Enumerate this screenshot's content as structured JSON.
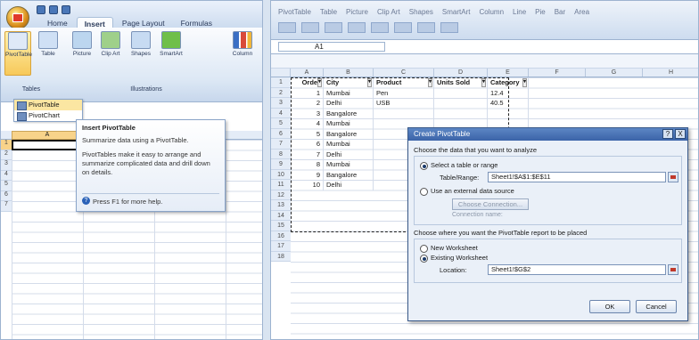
{
  "left": {
    "quick_access": [
      "save-icon",
      "undo-icon",
      "redo-icon"
    ],
    "tabs": [
      "Home",
      "Insert",
      "Page Layout",
      "Formulas"
    ],
    "active_tab": "Insert",
    "ribbon_buttons": [
      {
        "label": "PivotTable",
        "icon": "pivottable-icon",
        "highlight": true
      },
      {
        "label": "Table",
        "icon": "table-icon"
      },
      {
        "label": "Picture",
        "icon": "picture-icon"
      },
      {
        "label": "Clip Art",
        "icon": "clipart-icon"
      },
      {
        "label": "Shapes",
        "icon": "shapes-icon"
      },
      {
        "label": "SmartArt",
        "icon": "smartart-icon"
      },
      {
        "label": "Column",
        "icon": "column-chart-icon"
      }
    ],
    "group_labels": {
      "tables": "Tables",
      "illustrations": "Illustrations"
    },
    "dropdown_items": [
      "PivotTable",
      "PivotChart"
    ],
    "tooltip": {
      "title": "Insert PivotTable",
      "line1": "Summarize data using a PivotTable.",
      "line2": "PivotTables make it easy to arrange and summarize complicated data and drill down on details.",
      "help": "Press F1 for more help."
    },
    "col_header": "A",
    "rows": [
      "1",
      "2",
      "3",
      "4",
      "5",
      "6",
      "7"
    ]
  },
  "right": {
    "ribbon_tabs": [
      "PivotTable",
      "Table",
      "Picture",
      "Clip Art",
      "Shapes",
      "SmartArt",
      "Column",
      "Line",
      "Pie",
      "Bar",
      "Area"
    ],
    "name_box": "A1",
    "col_headers": [
      "",
      "A",
      "B",
      "C",
      "D",
      "E",
      "F",
      "G",
      "H"
    ],
    "row_numbers": [
      "1",
      "2",
      "3",
      "4",
      "5",
      "6",
      "7",
      "8",
      "9",
      "10",
      "11",
      "12",
      "13",
      "14",
      "15",
      "16",
      "17",
      "18"
    ],
    "table_headers": [
      "Order",
      "City",
      "Product",
      "Units Sold",
      "Category"
    ],
    "table_rows": [
      [
        "1",
        "Mumbai",
        "Pen",
        "",
        "12.4"
      ],
      [
        "2",
        "Delhi",
        "USB",
        "",
        "40.5"
      ],
      [
        "3",
        "Bangalore",
        "",
        "",
        ""
      ],
      [
        "4",
        "Mumbai",
        "",
        "",
        ""
      ],
      [
        "5",
        "Bangalore",
        "",
        "",
        ""
      ],
      [
        "6",
        "Mumbai",
        "",
        "",
        ""
      ],
      [
        "7",
        "Delhi",
        "",
        "",
        ""
      ],
      [
        "8",
        "Mumbai",
        "",
        "",
        ""
      ],
      [
        "9",
        "Bangalore",
        "",
        "",
        ""
      ],
      [
        "10",
        "Delhi",
        "",
        "",
        ""
      ]
    ]
  },
  "dialog": {
    "title": "Create PivotTable",
    "section1": "Choose the data that you want to analyze",
    "opt_select": "Select a table or range",
    "table_range_label": "Table/Range:",
    "table_range_value": "Sheet1!$A$1:$E$11",
    "opt_external": "Use an external data source",
    "choose_conn": "Choose Connection...",
    "conn_name": "Connection name:",
    "section2": "Choose where you want the PivotTable report to be placed",
    "opt_new": "New Worksheet",
    "opt_existing": "Existing Worksheet",
    "location_label": "Location:",
    "location_value": "Sheet1!$G$2",
    "ok": "OK",
    "cancel": "Cancel",
    "help_btn": "?",
    "close_btn": "X"
  }
}
